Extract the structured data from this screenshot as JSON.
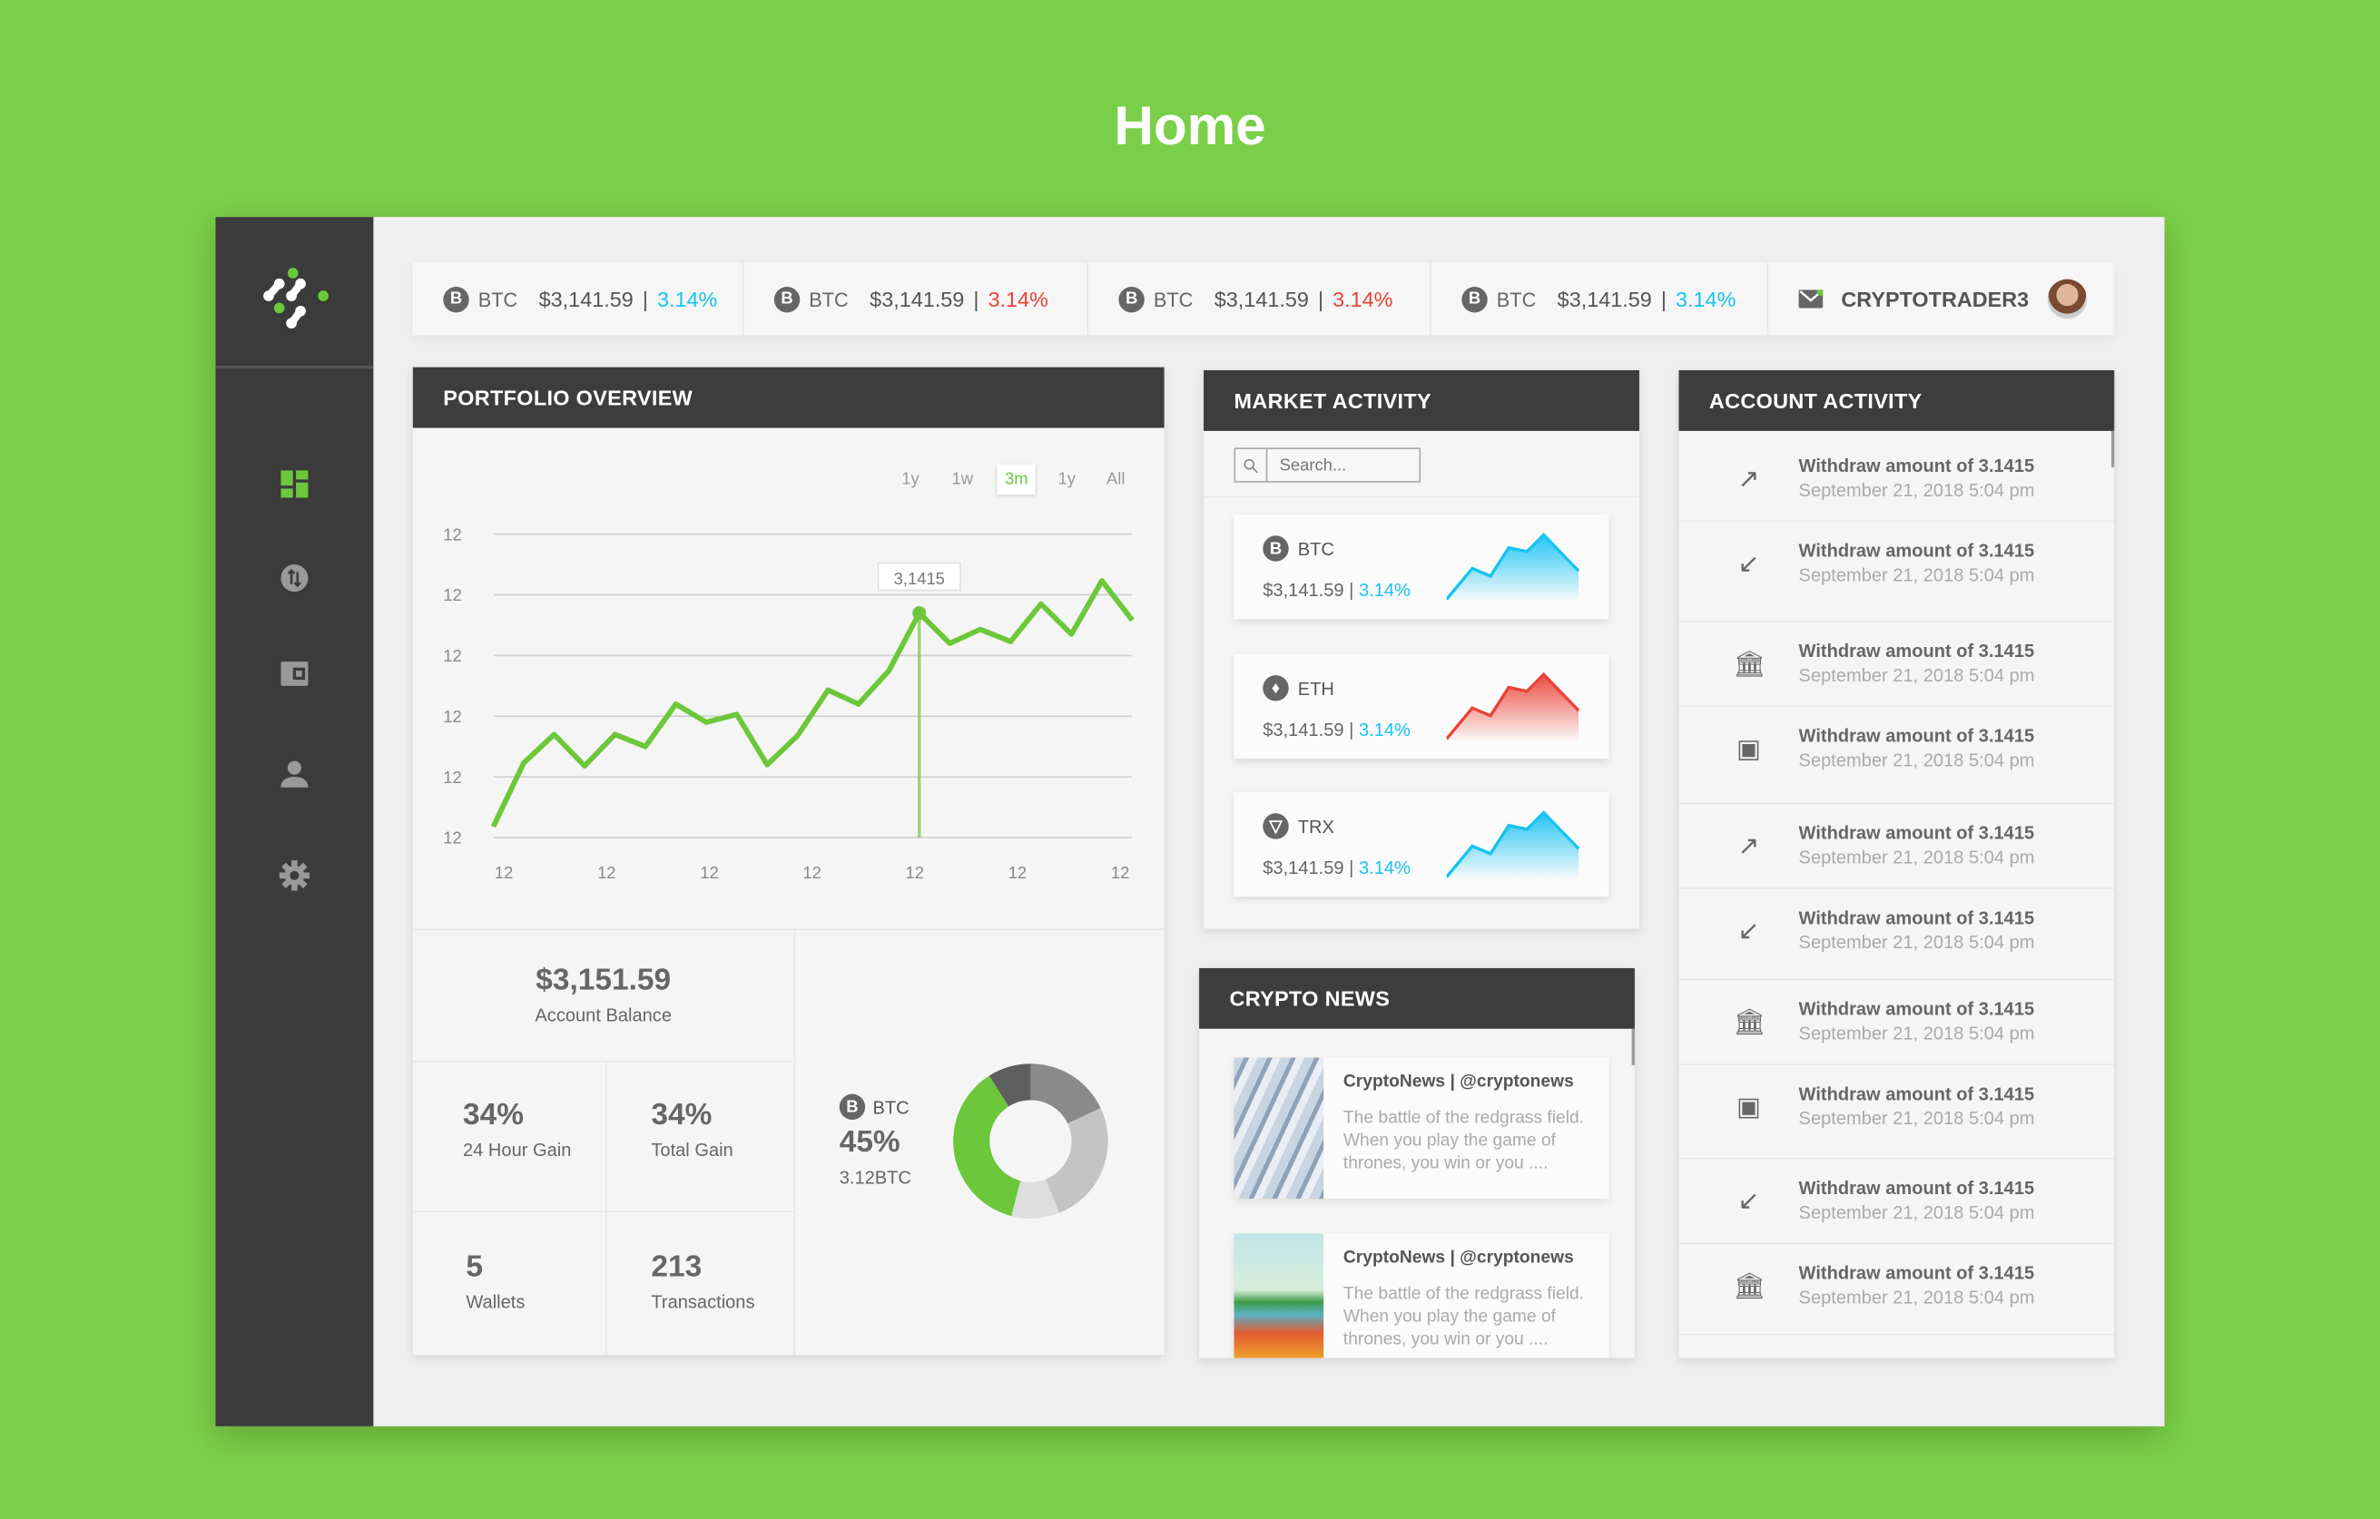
{
  "page_title": "Home",
  "colors": {
    "accent": "#6cc83a",
    "positive": "#16c2f2",
    "negative": "#ea4335",
    "header": "#3d3d3d",
    "sidebar": "#3b3b3b"
  },
  "sidebar": {
    "items": [
      {
        "icon": "dashboard-icon",
        "active": true
      },
      {
        "icon": "exchange-icon"
      },
      {
        "icon": "wallet-icon"
      },
      {
        "icon": "user-icon"
      },
      {
        "icon": "gear-icon"
      }
    ]
  },
  "ticker": [
    {
      "symbol": "BTC",
      "price": "$3,141.59",
      "sep": "|",
      "change": "3.14%",
      "direction": "up"
    },
    {
      "symbol": "BTC",
      "price": "$3,141.59",
      "sep": "|",
      "change": "3.14%",
      "direction": "down"
    },
    {
      "symbol": "BTC",
      "price": "$3,141.59",
      "sep": "|",
      "change": "3.14%",
      "direction": "down"
    },
    {
      "symbol": "BTC",
      "price": "$3,141.59",
      "sep": "|",
      "change": "3.14%",
      "direction": "up"
    }
  ],
  "user": {
    "name": "CRYPTOTRADER3",
    "mail_icon": "mail-icon"
  },
  "portfolio": {
    "title": "PORTFOLIO OVERVIEW",
    "ranges": [
      "1y",
      "1w",
      "3m",
      "1y",
      "All"
    ],
    "active_range": "3m",
    "tooltip": "3,1415",
    "balance": "$3,151.59",
    "balance_label": "Account Balance",
    "gain24": "34%",
    "gain24_label": "24 Hour Gain",
    "total_gain": "34%",
    "total_gain_label": "Total Gain",
    "wallets": "5",
    "wallets_label": "Wallets",
    "transactions": "213",
    "transactions_label": "Transactions",
    "coin": "BTC",
    "coin_pct": "45%",
    "coin_amount": "3.12BTC"
  },
  "chart_data": [
    {
      "type": "line",
      "title": "",
      "xlabel": "",
      "ylabel": "",
      "y_tick_labels": [
        "12",
        "12",
        "12",
        "12",
        "12",
        "12"
      ],
      "x_tick_labels": [
        "12",
        "12",
        "12",
        "12",
        "12",
        "12",
        "12"
      ],
      "ylim": [
        0,
        5
      ],
      "grid": true,
      "values": [
        0.18,
        1.23,
        1.7,
        1.18,
        1.7,
        1.5,
        2.2,
        1.9,
        2.03,
        1.2,
        1.68,
        2.43,
        2.2,
        2.75,
        3.7,
        3.2,
        3.43,
        3.23,
        3.85,
        3.35,
        4.23,
        3.58
      ],
      "highlight_index": 14,
      "color": "#6cc83a"
    },
    {
      "type": "pie",
      "donut": true,
      "title": "",
      "values": [
        0.18,
        0.26,
        0.1,
        0.37,
        0.09
      ],
      "colors": [
        "#8a8a8a",
        "#c4c4c4",
        "#dedede",
        "#6cc83a",
        "#5e5e5e"
      ]
    }
  ],
  "market": {
    "title": "MARKET ACTIVITY",
    "search_placeholder": "Search...",
    "items": [
      {
        "symbol": "BTC",
        "glyph": "B",
        "price": "$3,141.59",
        "sep": "|",
        "change": "3.14%",
        "color": "#16c2f2",
        "spark": [
          0,
          2.4,
          1.8,
          4,
          3.7,
          5,
          2.2
        ]
      },
      {
        "symbol": "ETH",
        "glyph": "♦",
        "price": "$3,141.59",
        "sep": "|",
        "change": "3.14%",
        "color": "#ea4335",
        "spark": [
          0,
          2.4,
          1.8,
          4,
          3.7,
          5,
          2.2
        ]
      },
      {
        "symbol": "TRX",
        "glyph": "▽",
        "price": "$3,141.59",
        "sep": "|",
        "change": "3.14%",
        "color": "#16c2f2",
        "spark": [
          0,
          2.4,
          1.8,
          4,
          3.7,
          5,
          2.2
        ]
      }
    ]
  },
  "news": {
    "title": "CRYPTO NEWS",
    "items": [
      {
        "source": "CryptoNews | @cryptonews",
        "text": "The battle of the redgrass field. When you play the game of thrones, you win or you ...."
      },
      {
        "source": "CryptoNews | @cryptonews",
        "text": "The battle of the redgrass field. When you play the game of thrones, you win or you ...."
      }
    ]
  },
  "account": {
    "title": "ACCOUNT ACTIVITY",
    "items": [
      {
        "icon": "arrow-up-right-icon",
        "glyph": "↗",
        "text": "Withdraw amount of 3.1415",
        "date": "September 21, 2018 5:04 pm"
      },
      {
        "icon": "arrow-down-left-icon",
        "glyph": "↙",
        "text": "Withdraw amount of 3.1415",
        "date": "September 21, 2018 5:04 pm"
      },
      {
        "icon": "bank-icon",
        "glyph": "🏛",
        "text": "Withdraw amount of 3.1415",
        "date": "September 21, 2018 5:04 pm"
      },
      {
        "icon": "wallet-icon",
        "glyph": "▣",
        "text": "Withdraw amount of 3.1415",
        "date": "September 21, 2018 5:04 pm"
      },
      {
        "icon": "arrow-up-right-icon",
        "glyph": "↗",
        "text": "Withdraw amount of 3.1415",
        "date": "September 21, 2018 5:04 pm"
      },
      {
        "icon": "arrow-down-left-icon",
        "glyph": "↙",
        "text": "Withdraw amount of 3.1415",
        "date": "September 21, 2018 5:04 pm"
      },
      {
        "icon": "bank-icon",
        "glyph": "🏛",
        "text": "Withdraw amount of 3.1415",
        "date": "September 21, 2018 5:04 pm"
      },
      {
        "icon": "wallet-icon",
        "glyph": "▣",
        "text": "Withdraw amount of 3.1415",
        "date": "September 21, 2018 5:04 pm"
      },
      {
        "icon": "arrow-down-left-icon",
        "glyph": "↙",
        "text": "Withdraw amount of 3.1415",
        "date": "September 21, 2018 5:04 pm"
      },
      {
        "icon": "bank-icon",
        "glyph": "🏛",
        "text": "Withdraw amount of 3.1415",
        "date": "September 21, 2018 5:04 pm"
      }
    ]
  }
}
